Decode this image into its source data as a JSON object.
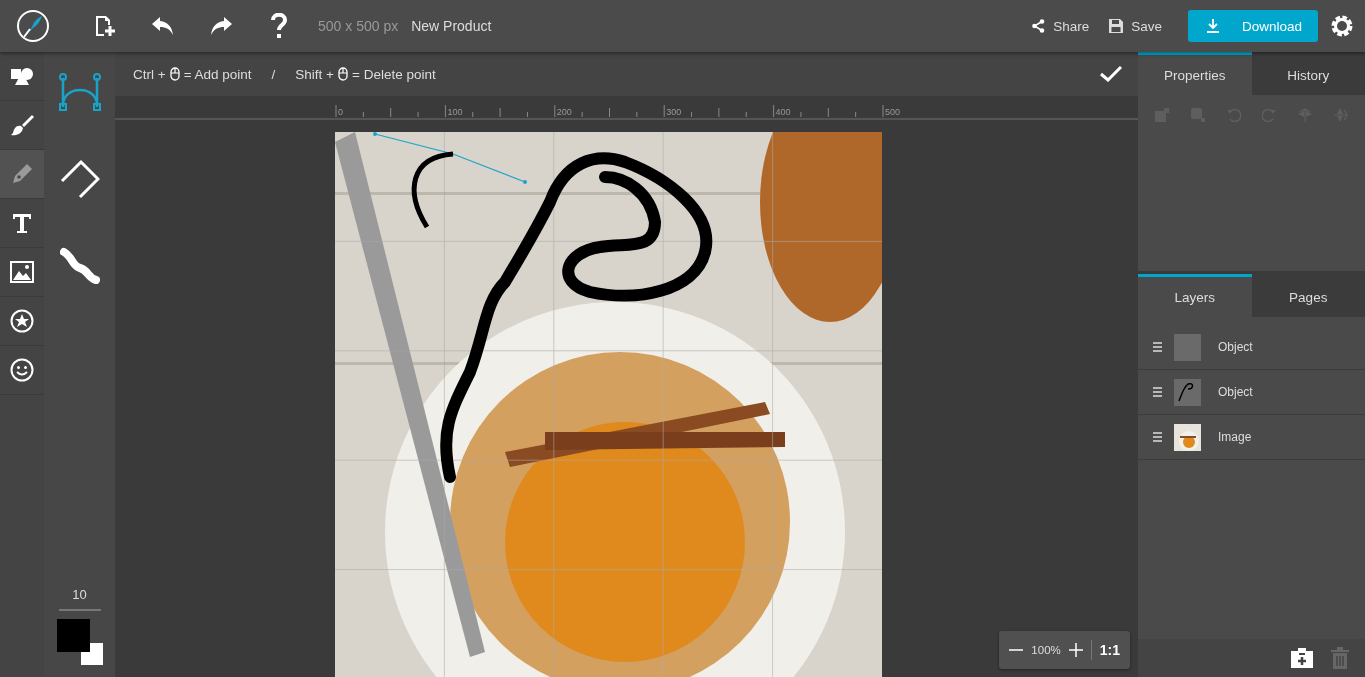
{
  "topbar": {
    "doc_size": "500 x 500 px",
    "doc_title": "New Product",
    "share": "Share",
    "save": "Save",
    "download": "Download"
  },
  "tools": [
    {
      "kind": "shapes",
      "selected": false
    },
    {
      "kind": "brush",
      "selected": false
    },
    {
      "kind": "pen",
      "selected": true
    },
    {
      "kind": "text",
      "selected": false
    },
    {
      "kind": "image",
      "selected": false
    },
    {
      "kind": "sticker",
      "selected": false
    },
    {
      "kind": "emoji",
      "selected": false
    }
  ],
  "pen_modes": [
    {
      "kind": "curve",
      "selected": true
    },
    {
      "kind": "polyline",
      "selected": false
    },
    {
      "kind": "freehand",
      "selected": false
    }
  ],
  "brush_size": "10",
  "hints": [
    {
      "modifier": "Ctrl +",
      "action": "= Add point"
    },
    {
      "modifier": "Shift +",
      "action": "= Delete point"
    }
  ],
  "hint_separator": "/",
  "ruler": [
    "0",
    "100",
    "200",
    "300",
    "400",
    "500"
  ],
  "zoom": {
    "value": "100%",
    "reset": "1:1"
  },
  "top_tabs": [
    {
      "label": "Properties",
      "selected": true
    },
    {
      "label": "History",
      "selected": false
    }
  ],
  "property_tools": [
    {
      "kind": "front",
      "disabled": true
    },
    {
      "kind": "back",
      "disabled": true
    },
    {
      "kind": "rotate_left",
      "disabled": true
    },
    {
      "kind": "rotate_right",
      "disabled": true
    },
    {
      "kind": "flip_h",
      "disabled": true
    },
    {
      "kind": "flip_v",
      "disabled": true
    }
  ],
  "bottom_tabs": [
    {
      "label": "Layers",
      "selected": true
    },
    {
      "label": "Pages",
      "selected": false
    }
  ],
  "layers": [
    {
      "name": "Object",
      "kind": "blank"
    },
    {
      "name": "Object",
      "kind": "stroke"
    },
    {
      "name": "Image",
      "kind": "photo"
    }
  ]
}
